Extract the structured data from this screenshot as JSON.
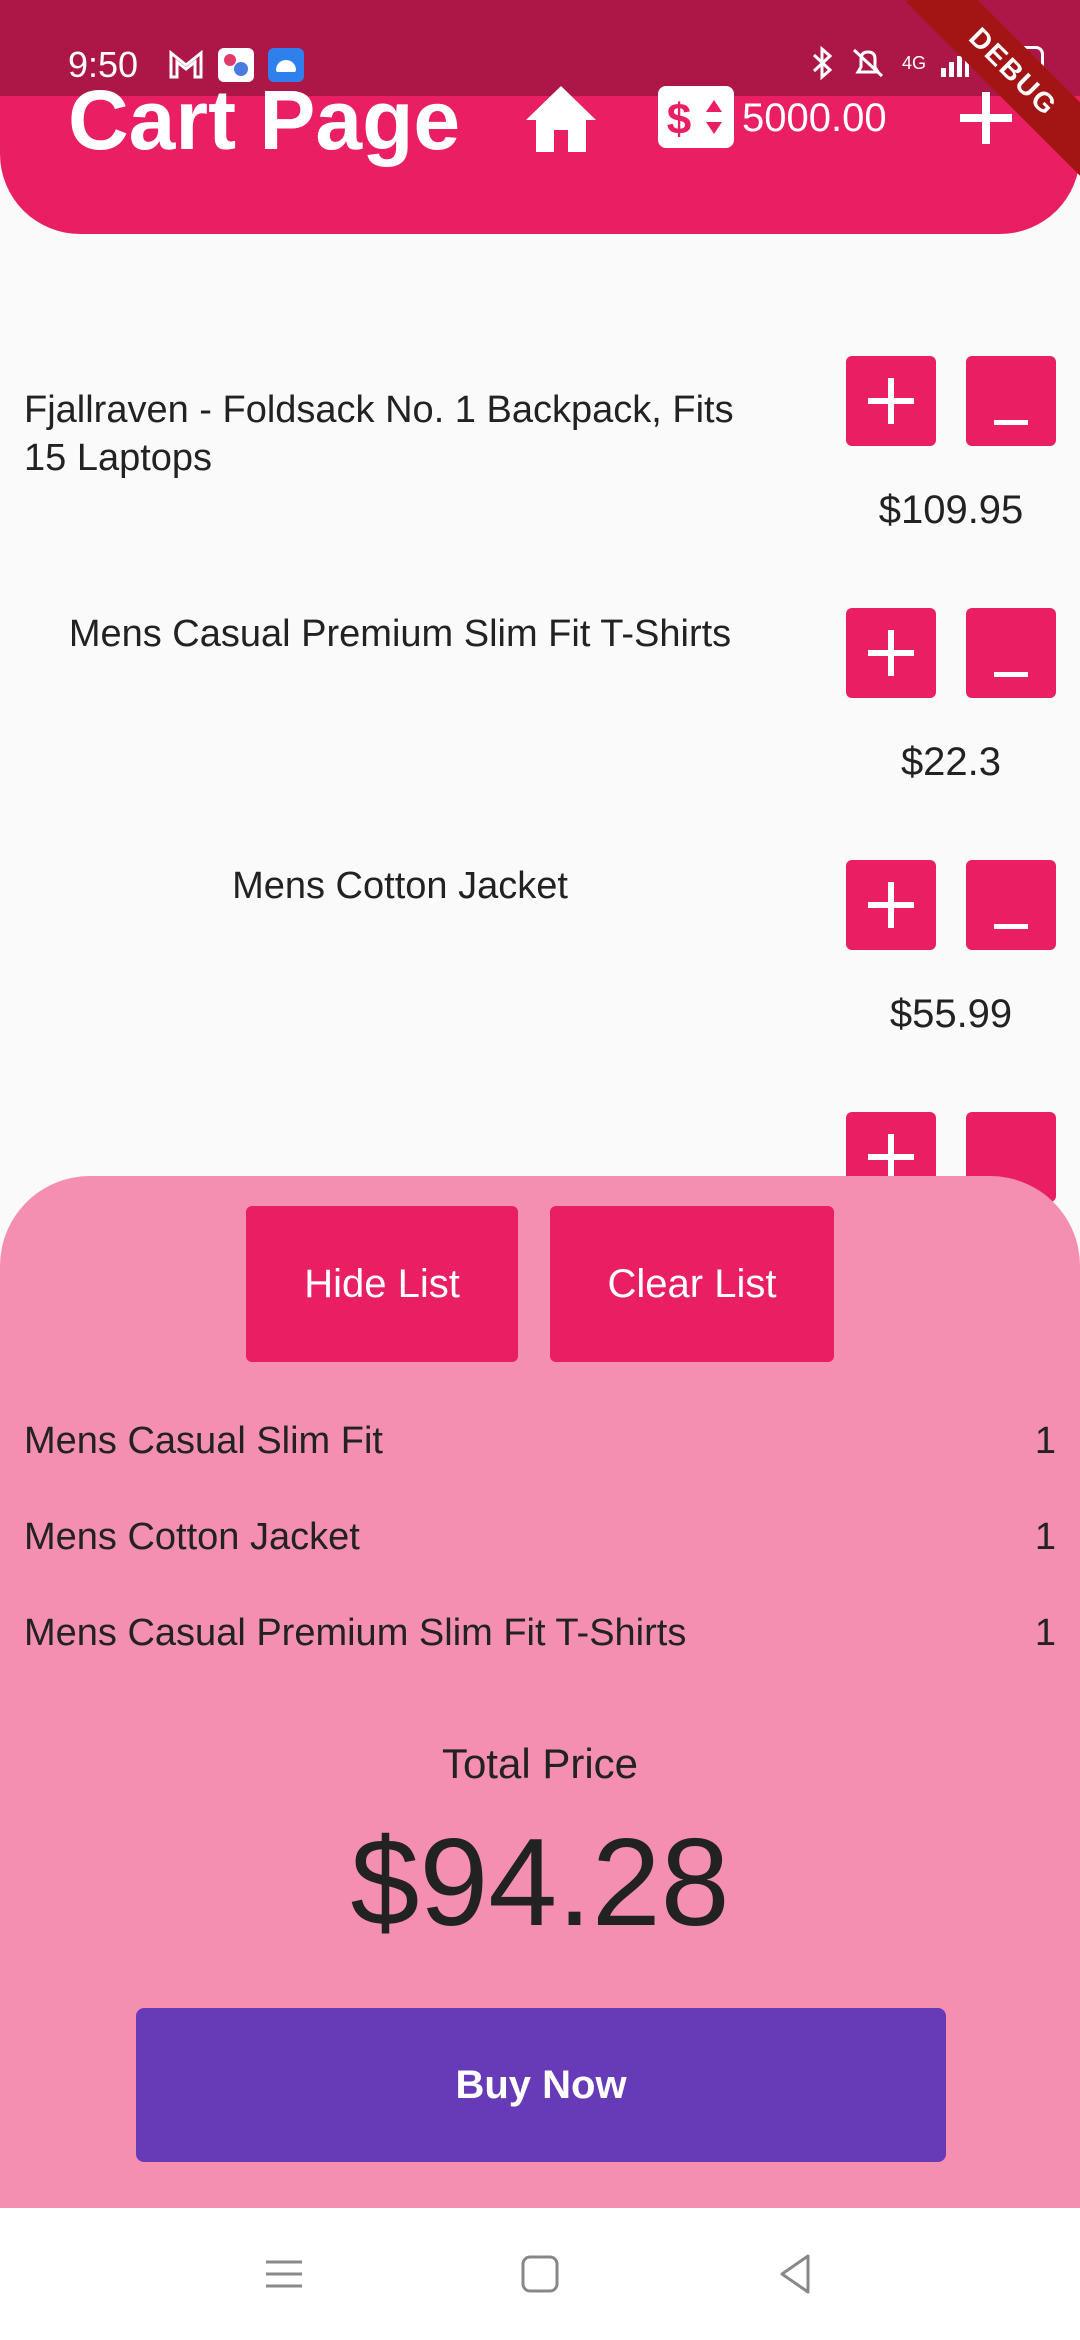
{
  "status_bar": {
    "time": "9:50",
    "network": "4G",
    "battery": "100"
  },
  "app_bar": {
    "title": "Cart Page",
    "balance": "5000.00",
    "icons": [
      "home-icon",
      "money-exchange-icon",
      "add-icon"
    ]
  },
  "debug_banner": "DEBUG",
  "cart_items": [
    {
      "name": "Fjallraven - Foldsack No. 1 Backpack, Fits 15 Laptops",
      "price": "$109.95"
    },
    {
      "name": "Mens Casual Premium Slim Fit T-Shirts",
      "price": "$22.3"
    },
    {
      "name": "Mens Cotton Jacket",
      "price": "$55.99"
    }
  ],
  "sheet": {
    "hide_label": "Hide List",
    "clear_label": "Clear List",
    "items": [
      {
        "name": "Mens Casual Slim Fit",
        "qty": "1"
      },
      {
        "name": "Mens Cotton Jacket",
        "qty": "1"
      },
      {
        "name": "Mens Casual Premium Slim Fit T-Shirts",
        "qty": "1"
      }
    ],
    "total_label": "Total Price",
    "total_value": "$94.28",
    "buy_label": "Buy Now"
  },
  "colors": {
    "primary": "#E91E63",
    "primary_dark": "#AD1748",
    "sheet_bg": "#F48FB1",
    "buy_button": "#673AB7"
  }
}
